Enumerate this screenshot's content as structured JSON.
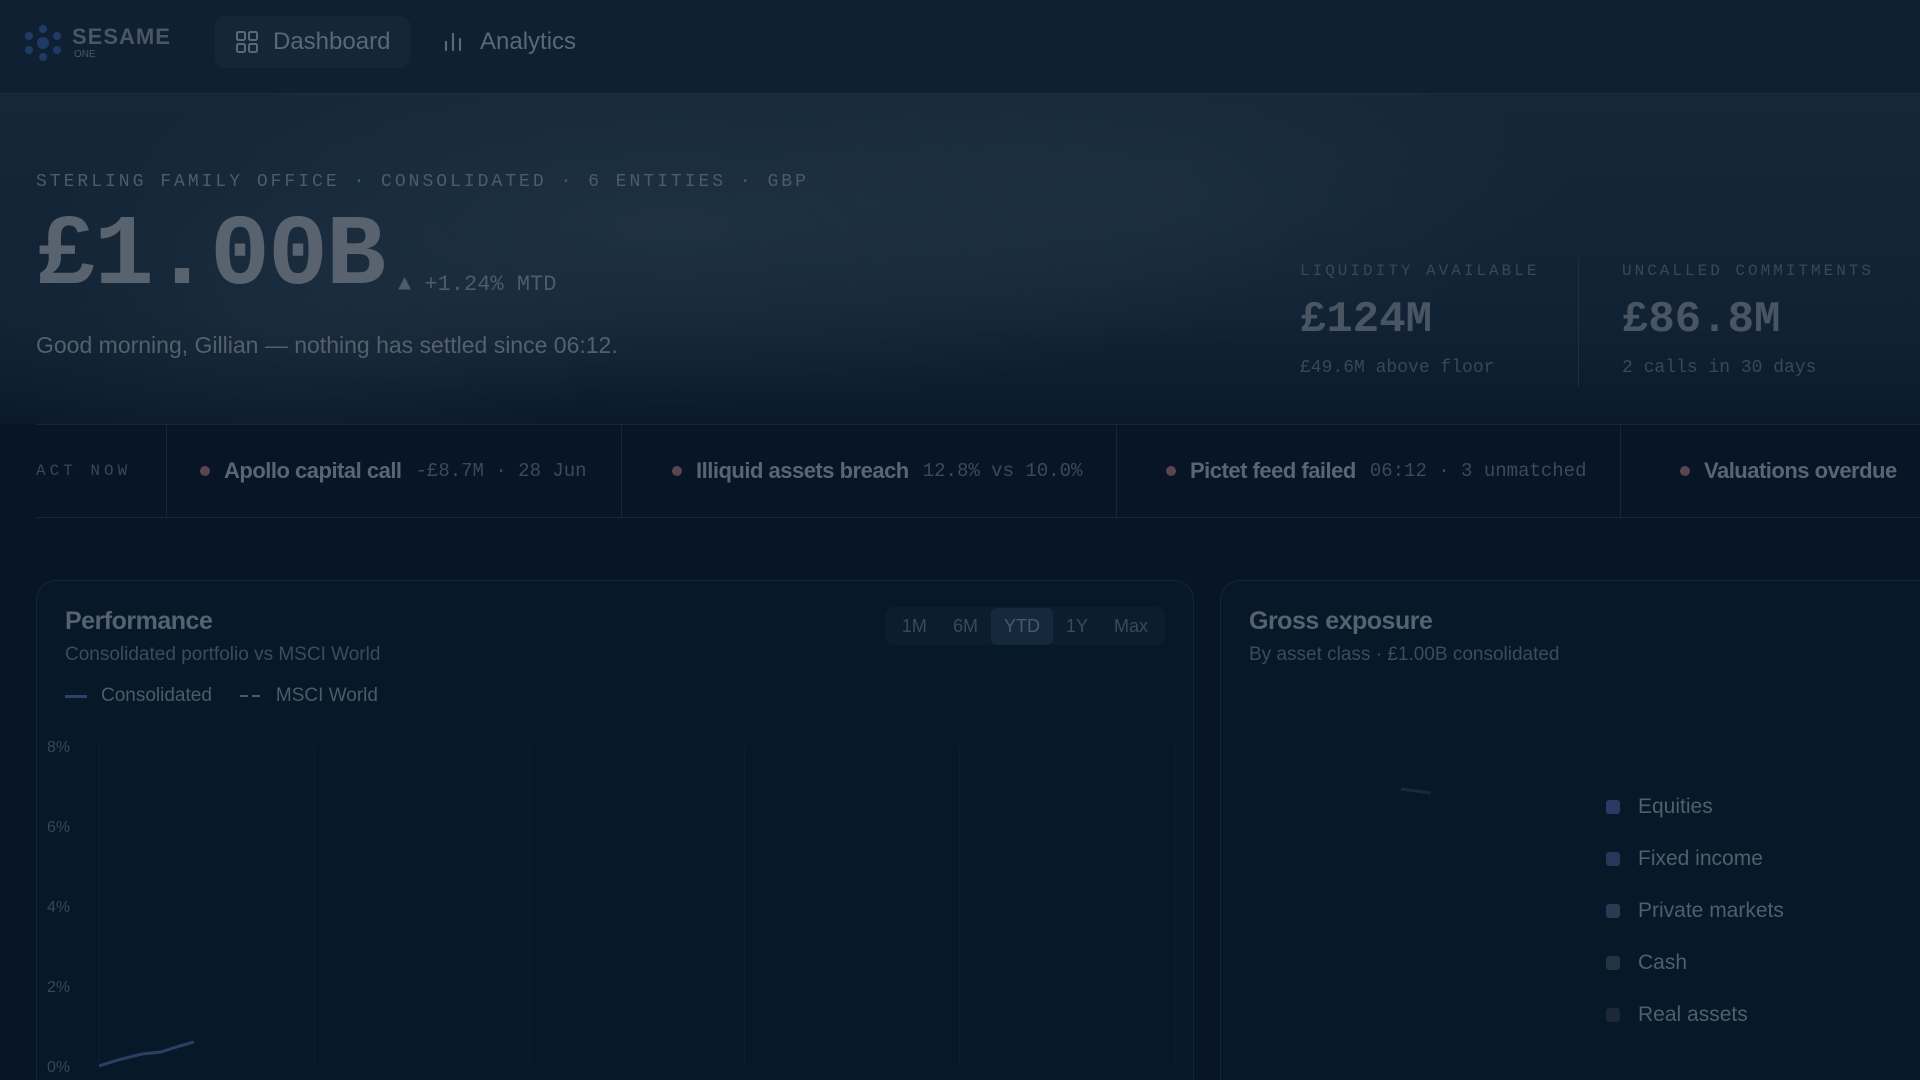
{
  "brand": {
    "name": "SESAME",
    "sub": "ONE"
  },
  "nav": [
    {
      "label": "Dashboard",
      "active": true,
      "icon": "grid-icon"
    },
    {
      "label": "Analytics",
      "active": false,
      "icon": "bar-chart-icon"
    }
  ],
  "hero": {
    "subtitle": "STERLING FAMILY OFFICE · CONSOLIDATED · 6 ENTITIES · GBP",
    "value": "£1.00B",
    "change": "▲ +1.24% MTD",
    "greeting": "Good morning, Gillian — nothing has settled since 06:12."
  },
  "stats": [
    {
      "label": "LIQUIDITY AVAILABLE",
      "value": "£124M",
      "note": "£49.6M above floor"
    },
    {
      "label": "UNCALLED COMMITMENTS",
      "value": "£86.8M",
      "note": "2 calls in 30 days"
    }
  ],
  "act_now": {
    "label": "ACT NOW",
    "items": [
      {
        "title": "Apollo capital call",
        "detail": "-£8.7M · 28 Jun"
      },
      {
        "title": "Illiquid assets breach",
        "detail": "12.8% vs 10.0%"
      },
      {
        "title": "Pictet feed failed",
        "detail": "06:12 · 3 unmatched"
      },
      {
        "title": "Valuations overdue",
        "detail": ""
      }
    ]
  },
  "performance": {
    "title": "Performance",
    "subtitle": "Consolidated portfolio vs MSCI World",
    "legend": [
      "Consolidated",
      "MSCI World"
    ],
    "ranges": [
      "1M",
      "6M",
      "YTD",
      "1Y",
      "Max"
    ],
    "active_range": "YTD"
  },
  "exposure": {
    "title": "Gross exposure",
    "subtitle": "By asset class · £1.00B consolidated",
    "legend": [
      {
        "label": "Equities",
        "color": "#2a3a63"
      },
      {
        "label": "Fixed income",
        "color": "#28365a"
      },
      {
        "label": "Private markets",
        "color": "#2b3a52"
      },
      {
        "label": "Cash",
        "color": "#25323f"
      },
      {
        "label": "Real assets",
        "color": "#1c2835"
      }
    ]
  },
  "chart_data": {
    "type": "line",
    "title": "Performance",
    "ylabel": "",
    "yticks": [
      "8%",
      "6%",
      "4%",
      "2%",
      "0%"
    ],
    "ylim": [
      0,
      8
    ],
    "grid": true,
    "series": [
      {
        "name": "Consolidated",
        "x": [
          0,
          0.2,
          0.45,
          0.65,
          0.85,
          1.0
        ],
        "values": [
          0,
          0.15,
          0.3,
          0.35,
          0.5,
          0.6
        ]
      }
    ]
  }
}
